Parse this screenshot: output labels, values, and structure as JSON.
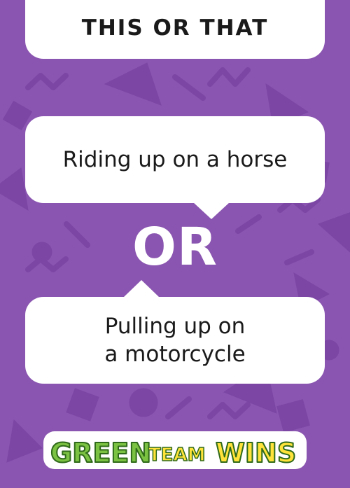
{
  "header": {
    "title": "THIS OR THAT"
  },
  "options": {
    "first": "Riding up on a horse",
    "first_line1": "Riding up on a horse",
    "second_line1": "Pulling up on",
    "second_line2": "a motorcycle"
  },
  "divider": {
    "label": "OR"
  },
  "logo": {
    "word1": "GREEN",
    "word2": "TEAM",
    "word3": "WINS"
  },
  "colors": {
    "background": "#8a55b0",
    "pattern": "#7a44a3",
    "card": "#ffffff",
    "logo_green": "#7cc242",
    "logo_yellow": "#ffe33a"
  }
}
